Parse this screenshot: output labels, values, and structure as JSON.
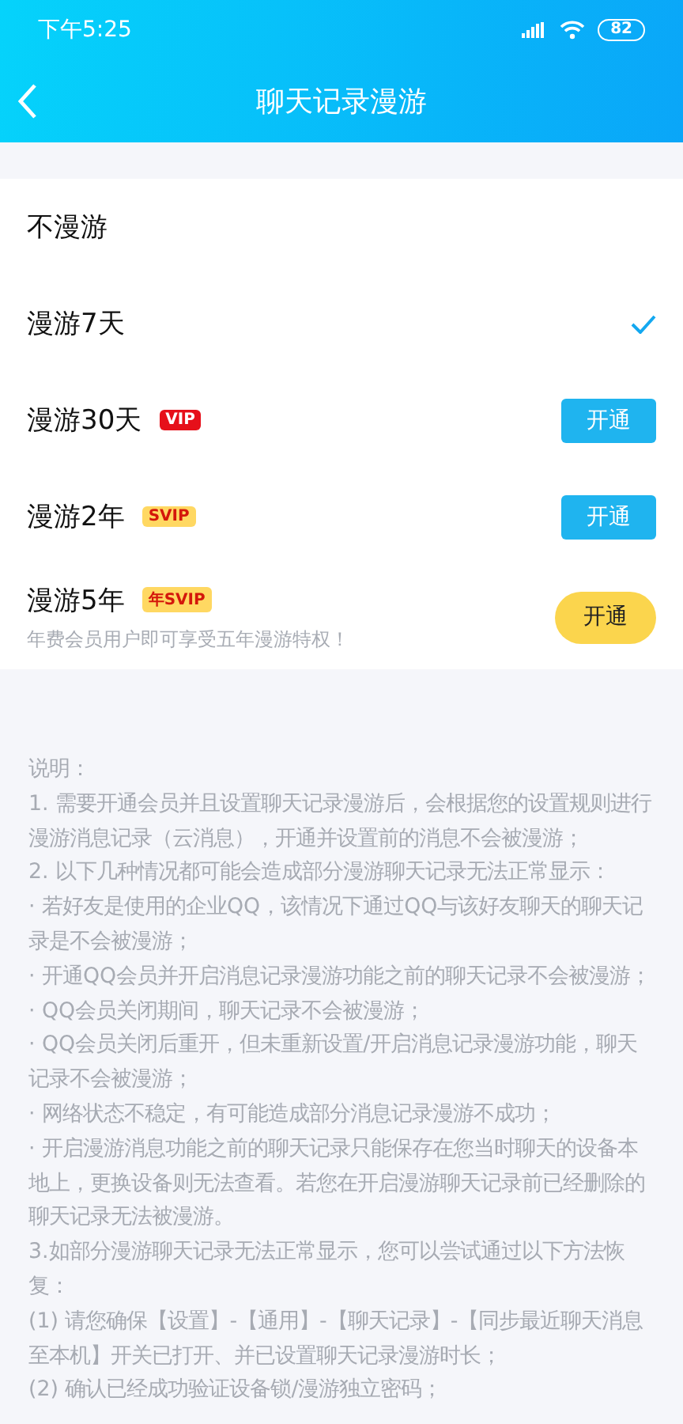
{
  "status_bar": {
    "time": "下午5:25",
    "battery": "82"
  },
  "nav": {
    "title": "聊天记录漫游"
  },
  "options": [
    {
      "label": "不漫游",
      "selected": false
    },
    {
      "label": "漫游7天",
      "selected": true
    },
    {
      "label": "漫游30天",
      "selected": false,
      "badge": {
        "text": "VIP",
        "kind": "vip"
      },
      "action": {
        "text": "开通",
        "kind": "primary"
      }
    },
    {
      "label": "漫游2年",
      "selected": false,
      "badge": {
        "text": "SVIP",
        "kind": "svip"
      },
      "action": {
        "text": "开通",
        "kind": "primary"
      }
    },
    {
      "label": "漫游5年",
      "selected": false,
      "badge": {
        "text": "年SVIP",
        "kind": "svip"
      },
      "action": {
        "text": "开通",
        "kind": "gold"
      },
      "note": "年费会员用户即可享受五年漫游特权！"
    }
  ],
  "notes": [
    "说明：",
    "1. 需要开通会员并且设置聊天记录漫游后，会根据您的设置规则进行漫游消息记录（云消息），开通并设置前的消息不会被漫游；",
    "2. 以下几种情况都可能会造成部分漫游聊天记录无法正常显示：",
    "· 若好友是使用的企业QQ，该情况下通过QQ与该好友聊天的聊天记录是不会被漫游；",
    "· 开通QQ会员并开启消息记录漫游功能之前的聊天记录不会被漫游；",
    "· QQ会员关闭期间，聊天记录不会被漫游；",
    "· QQ会员关闭后重开，但未重新设置/开启消息记录漫游功能，聊天记录不会被漫游；",
    "· 网络状态不稳定，有可能造成部分消息记录漫游不成功；",
    "· 开启漫游消息功能之前的聊天记录只能保存在您当时聊天的设备本地上，更换设备则无法查看。若您在开启漫游聊天记录前已经删除的聊天记录无法被漫游。",
    "3.如部分漫游聊天记录无法正常显示，您可以尝试通过以下方法恢复：",
    "(1) 请您确保【设置】-【通用】-【聊天记录】-【同步最近聊天消息至本机】开关已打开、并已设置聊天记录漫游时长；",
    "(2) 确认已经成功验证设备锁/漫游独立密码；"
  ]
}
